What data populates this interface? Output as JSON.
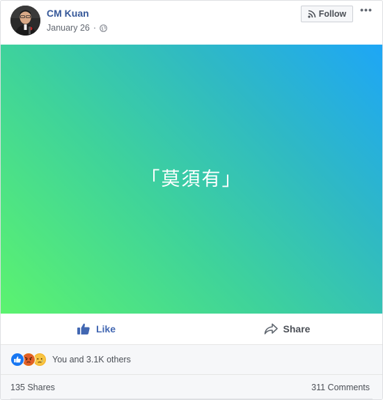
{
  "post": {
    "author": "CM Kuan",
    "date": "January 26",
    "separator": "·",
    "follow_label": "Follow",
    "more_label": "•••",
    "media_text": "「莫須有」",
    "actions": {
      "like": "Like",
      "share": "Share"
    },
    "reactions_text": "You and 3.1K others",
    "shares_text": "135 Shares",
    "comments_text": "311 Comments",
    "icons": [
      "globe-icon",
      "rss-icon",
      "thumbs-up-icon",
      "share-arrow-icon",
      "like-reaction-icon",
      "angry-reaction-icon",
      "sad-reaction-icon"
    ],
    "colors": {
      "link_blue": "#365899",
      "like_blue": "#4267b2",
      "gradient_start": "#5cf36f",
      "gradient_end": "#1ea6f6"
    }
  }
}
